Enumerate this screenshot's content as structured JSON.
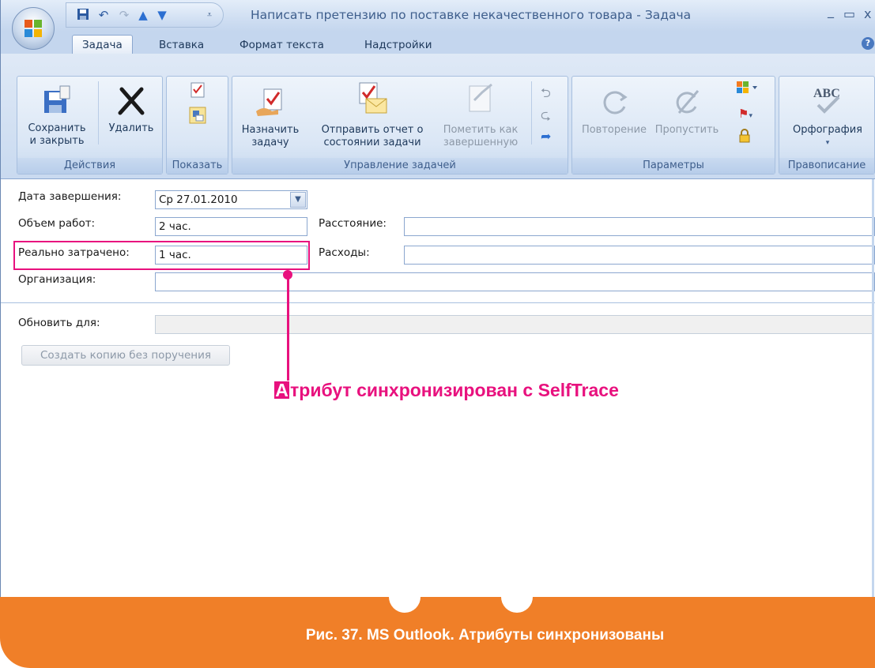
{
  "window": {
    "title": "Написать претензию по поставке некачественного товара - Задача",
    "minimize": "_",
    "maximize": "▭",
    "close": "x"
  },
  "tabs": [
    {
      "label": "Задача"
    },
    {
      "label": "Вставка"
    },
    {
      "label": "Формат текста"
    },
    {
      "label": "Надстройки"
    }
  ],
  "ribbon": {
    "groups": {
      "actions": "Действия",
      "show": "Показать",
      "manage": "Управление задачей",
      "options": "Параметры",
      "spelling": "Правописание"
    },
    "buttons": {
      "save_line1": "Сохранить",
      "save_line2": "и закрыть",
      "delete": "Удалить",
      "assign_line1": "Назначить",
      "assign_line2": "задачу",
      "report_line1": "Отправить отчет о",
      "report_line2": "состоянии задачи",
      "mark_line1": "Пометить как",
      "mark_line2": "завершенную",
      "recurrence": "Повторение",
      "skip": "Пропустить",
      "spelling": "Орфография"
    }
  },
  "form": {
    "due_date_label": "Дата завершения:",
    "due_date_value": "Ср 27.01.2010",
    "total_work_label": "Объем работ:",
    "total_work_value": "2 час.",
    "actual_work_label": "Реально затрачено:",
    "actual_work_value": "1 час.",
    "mileage_label": "Расстояние:",
    "mileage_value": "",
    "billing_label": "Расходы:",
    "billing_value": "",
    "companies_label": "Организация:",
    "companies_value": "",
    "update_list_label": "Обновить для:",
    "update_list_value": "",
    "copy_button": "Создать копию без поручения"
  },
  "callout": {
    "badge": "A",
    "text": "трибут синхронизирован с SelfTrace",
    "color": "#e8117e"
  },
  "footer": {
    "caption": "Рис. 37. MS Outlook. Атрибуты синхронизованы",
    "color": "#f07f28"
  }
}
